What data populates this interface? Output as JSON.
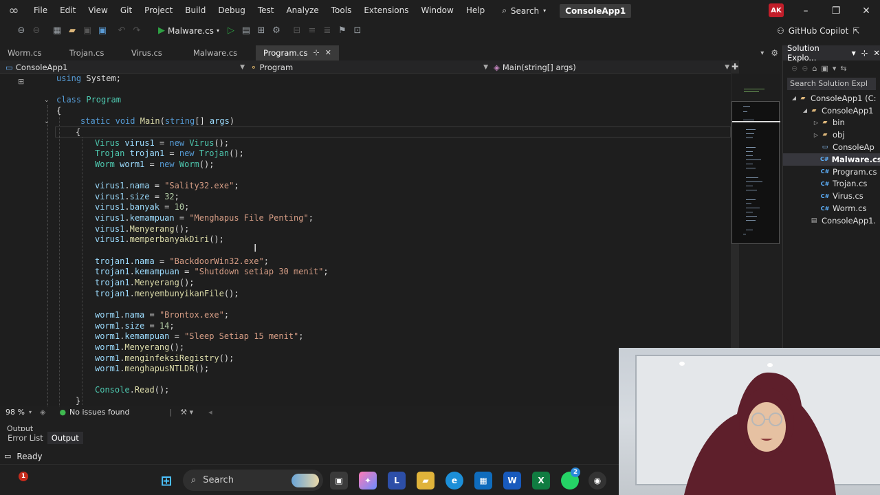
{
  "menu": {
    "items": [
      "File",
      "Edit",
      "View",
      "Git",
      "Project",
      "Build",
      "Debug",
      "Test",
      "Analyze",
      "Tools",
      "Extensions",
      "Window",
      "Help"
    ],
    "search_label": "Search",
    "solution_name": "ConsoleApp1",
    "avatar_initials": "AK"
  },
  "toolbar": {
    "run_target": "Malware.cs",
    "copilot_label": "GitHub Copilot"
  },
  "tabs": [
    {
      "label": "Worm.cs",
      "active": false
    },
    {
      "label": "Trojan.cs",
      "active": false
    },
    {
      "label": "Virus.cs",
      "active": false
    },
    {
      "label": "Malware.cs",
      "active": false
    },
    {
      "label": "Program.cs",
      "active": true
    }
  ],
  "navbar": {
    "project": "ConsoleApp1",
    "type": "Program",
    "member": "Main(string[] args)"
  },
  "code": [
    {
      "text": "using System;"
    },
    {
      "text": ""
    },
    {
      "text": "class Program"
    },
    {
      "text": "{"
    },
    {
      "text": "static void Main(string[] args)"
    },
    {
      "text": "{"
    },
    {
      "text": "Virus virus1 = new Virus();"
    },
    {
      "text": "Trojan trojan1 = new Trojan();"
    },
    {
      "text": "Worm worm1 = new Worm();"
    },
    {
      "text": ""
    },
    {
      "text": "virus1.nama = \"Sality32.exe\";"
    },
    {
      "text": "virus1.size = 32;"
    },
    {
      "text": "virus1.banyak = 10;"
    },
    {
      "text": "virus1.kemampuan = \"Menghapus File Penting\";"
    },
    {
      "text": "virus1.Menyerang();"
    },
    {
      "text": "virus1.memperbanyakDiri();"
    },
    {
      "text": ""
    },
    {
      "text": "trojan1.nama = \"BackdoorWin32.exe\";"
    },
    {
      "text": "trojan1.kemampuan = \"Shutdown setiap 30 menit\";"
    },
    {
      "text": "trojan1.Menyerang();"
    },
    {
      "text": "trojan1.menyembunyikanFile();"
    },
    {
      "text": ""
    },
    {
      "text": "worm1.nama = \"Brontox.exe\";"
    },
    {
      "text": "worm1.size = 14;"
    },
    {
      "text": "worm1.kemampuan = \"Sleep Setiap 15 menit\";"
    },
    {
      "text": "worm1.Menyerang();"
    },
    {
      "text": "worm1.menginfeksiRegistry();"
    },
    {
      "text": "worm1.menghapusNTLDR();"
    },
    {
      "text": ""
    },
    {
      "text": "Console.Read();"
    },
    {
      "text": "}"
    }
  ],
  "solution_explorer": {
    "title": "Solution Explo...",
    "search_placeholder": "Search Solution Expl",
    "items": [
      {
        "label": "ConsoleApp1 (C:",
        "icon": "folder-icon"
      },
      {
        "label": "ConsoleApp1",
        "icon": "folder-icon"
      },
      {
        "label": "bin",
        "icon": "folder-icon"
      },
      {
        "label": "obj",
        "icon": "folder-icon"
      },
      {
        "label": "ConsoleAp",
        "icon": "project-icon"
      },
      {
        "label": "Malware.cs",
        "icon": "csharp-file-icon"
      },
      {
        "label": "Program.cs",
        "icon": "csharp-file-icon"
      },
      {
        "label": "Trojan.cs",
        "icon": "csharp-file-icon"
      },
      {
        "label": "Virus.cs",
        "icon": "csharp-file-icon"
      },
      {
        "label": "Worm.cs",
        "icon": "csharp-file-icon"
      },
      {
        "label": "ConsoleApp1.",
        "icon": "config-file-icon"
      }
    ]
  },
  "editor_status": {
    "zoom": "98 %",
    "issues": "No issues found"
  },
  "output_header": "Output",
  "bottom_tabs": [
    "Error List",
    "Output"
  ],
  "status": "Ready",
  "taskbar": {
    "search_label": "Search",
    "badge_count": "1",
    "whatsapp_count": "2"
  }
}
